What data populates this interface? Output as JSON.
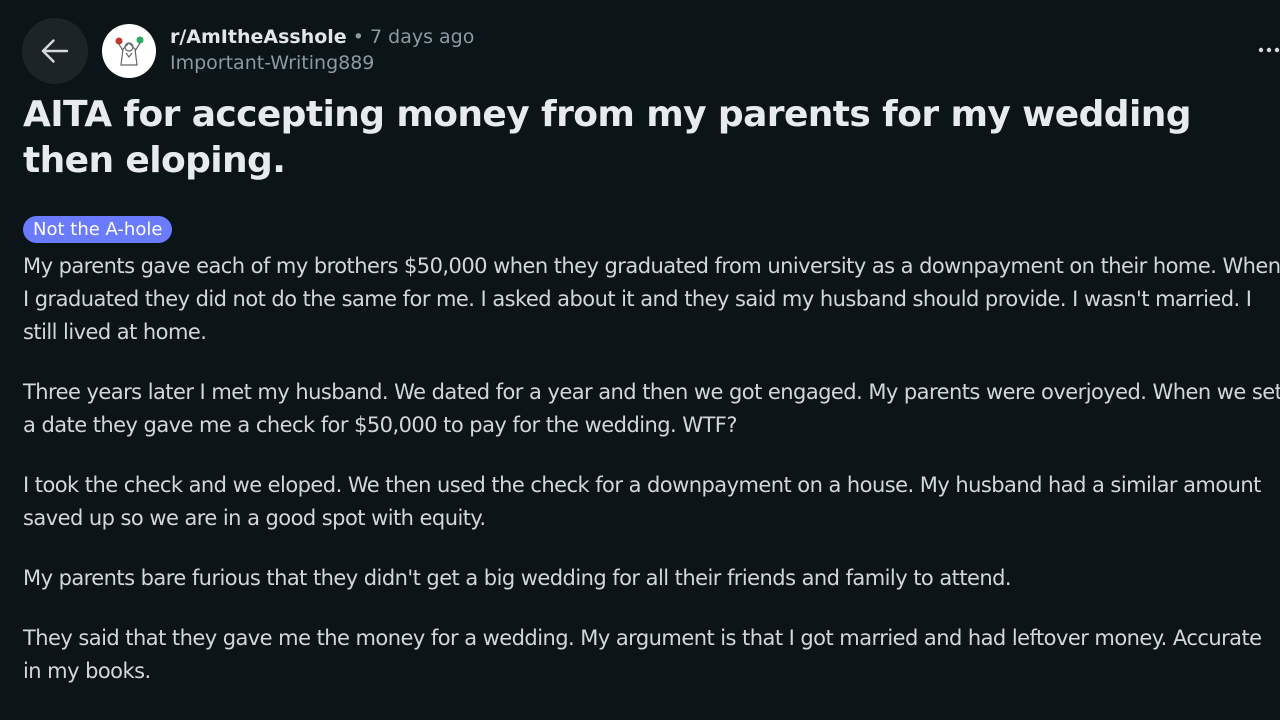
{
  "post": {
    "subreddit": "r/AmItheAsshole",
    "separator": "•",
    "time_ago": "7 days ago",
    "author": "Important-Writing889",
    "title": "AITA for accepting money from my parents for my wedding then eloping.",
    "flair": "Not the A-hole",
    "paragraphs": [
      "My parents gave each of my brothers $50,000 when they graduated from university as a downpayment on their home. When I graduated they did not do the same for me. I asked about it and they said my husband should provide. I wasn't married. I still lived at home.",
      "Three years later I met my husband. We dated for a year and then we got engaged. My parents were overjoyed. When we set a date they gave me a check for $50,000 to pay for the wedding. WTF?",
      "I took the check and we eloped. We then used the check for a downpayment on a house. My husband had a similar amount saved up so we are in a good spot with equity.",
      "My parents bare furious that they didn't get a big wedding for all their friends and family to attend.",
      "They said that they gave me the money for a wedding. My argument is that I got married and had leftover money. Accurate in my books."
    ]
  },
  "icons": {
    "back": "arrow-left-icon",
    "more": "more-horizontal-icon",
    "avatar": "subreddit-avatar"
  },
  "colors": {
    "background": "#0b1416",
    "flair_bg": "#6b7bff",
    "muted_text": "#8b9aa3"
  }
}
